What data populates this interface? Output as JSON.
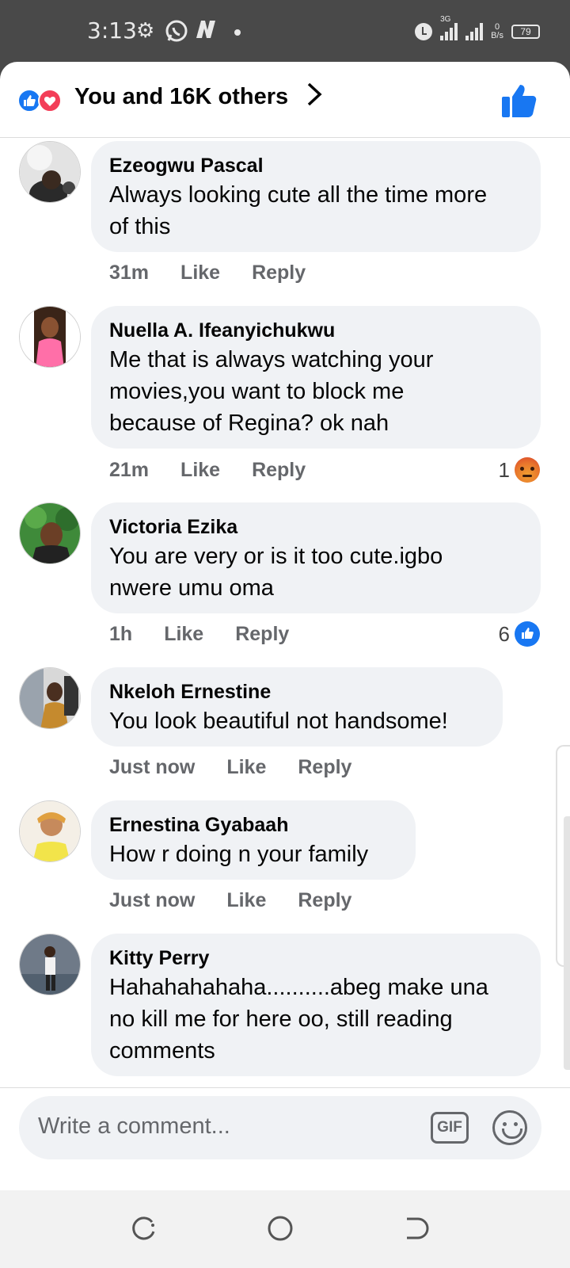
{
  "status_bar": {
    "time": "3:13",
    "network": "3G",
    "speed_value": "0",
    "speed_unit": "B/s",
    "battery": "79"
  },
  "reactions": {
    "summary": "You and 16K others",
    "icons": [
      "like-icon",
      "love-icon"
    ]
  },
  "comments": [
    {
      "author": "Ezeogwu Pascal",
      "text": "Always looking cute all the time more\nof this",
      "time": "31m",
      "like": "Like",
      "reply": "Reply",
      "reaction_count": "",
      "reaction_type": ""
    },
    {
      "author": "Nuella A. Ifeanyichukwu",
      "text": "Me that is always watching your\nmovies,you want to block me\nbecause of Regina? ok nah",
      "time": "21m",
      "like": "Like",
      "reply": "Reply",
      "reaction_count": "1",
      "reaction_type": "angry"
    },
    {
      "author": "Victoria Ezika",
      "text": "You are very or is it too cute.igbo\nnwere umu oma",
      "time": "1h",
      "like": "Like",
      "reply": "Reply",
      "reaction_count": "6",
      "reaction_type": "like"
    },
    {
      "author": "Nkeloh Ernestine",
      "text": "You look beautiful not handsome!",
      "time": "Just now",
      "like": "Like",
      "reply": "Reply",
      "reaction_count": "",
      "reaction_type": ""
    },
    {
      "author": "Ernestina Gyabaah",
      "text": "How r doing n your family",
      "time": "Just now",
      "like": "Like",
      "reply": "Reply",
      "reaction_count": "",
      "reaction_type": ""
    },
    {
      "author": "Kitty Perry",
      "text": "Hahahahahaha..........abeg make una\nno kill me for here oo, still reading\ncomments",
      "time": "",
      "like": "",
      "reply": "",
      "reaction_count": "",
      "reaction_type": ""
    }
  ],
  "composer": {
    "placeholder": "Write a comment...",
    "gif_label": "GIF"
  },
  "colors": {
    "accent": "#1877f2",
    "love": "#f33e58",
    "bubble": "#f0f2f5",
    "meta_text": "#65676b"
  }
}
